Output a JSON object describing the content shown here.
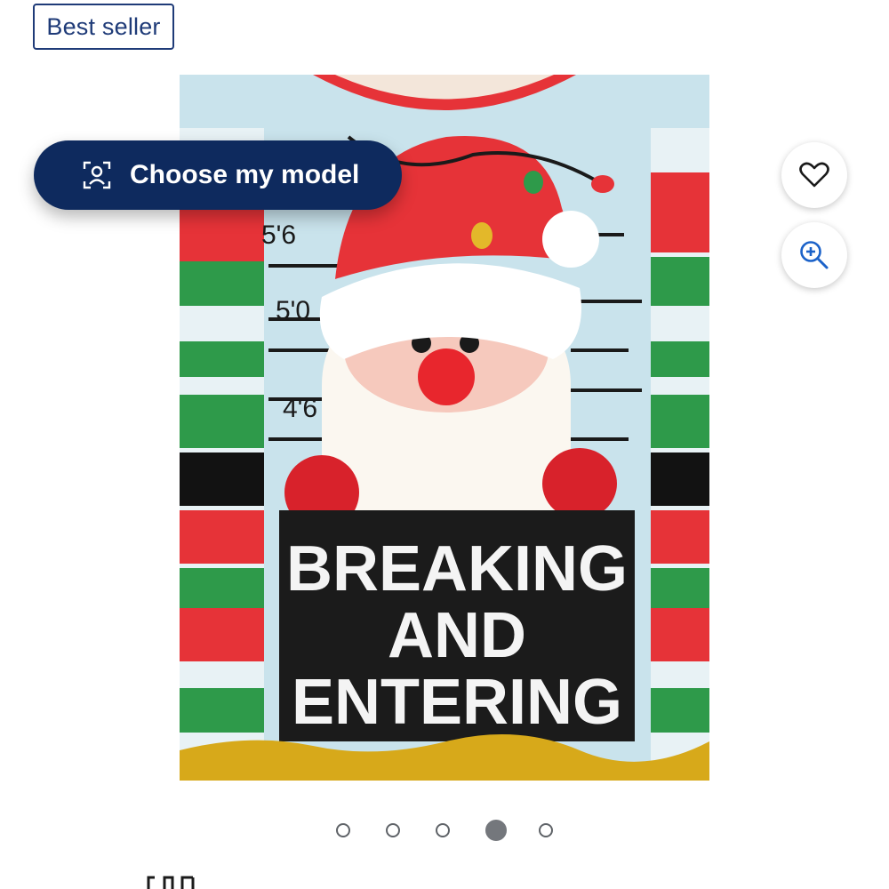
{
  "badge": {
    "label": "Best seller"
  },
  "model_button": {
    "label": "Choose my model",
    "icon": "person-scan-icon"
  },
  "actions": {
    "favorite_icon": "heart-icon",
    "zoom_icon": "zoom-in-icon"
  },
  "product_image": {
    "description_text": {
      "line1": "BREAKING",
      "line2": "AND",
      "line3": "ENTERING"
    },
    "height_marks": [
      "5'6",
      "5'0",
      "4'6"
    ]
  },
  "carousel": {
    "count": 5,
    "active_index": 3
  },
  "colors": {
    "navy": "#0e2a5e",
    "badge_border": "#1f3b78",
    "dot_active": "#74777c"
  }
}
